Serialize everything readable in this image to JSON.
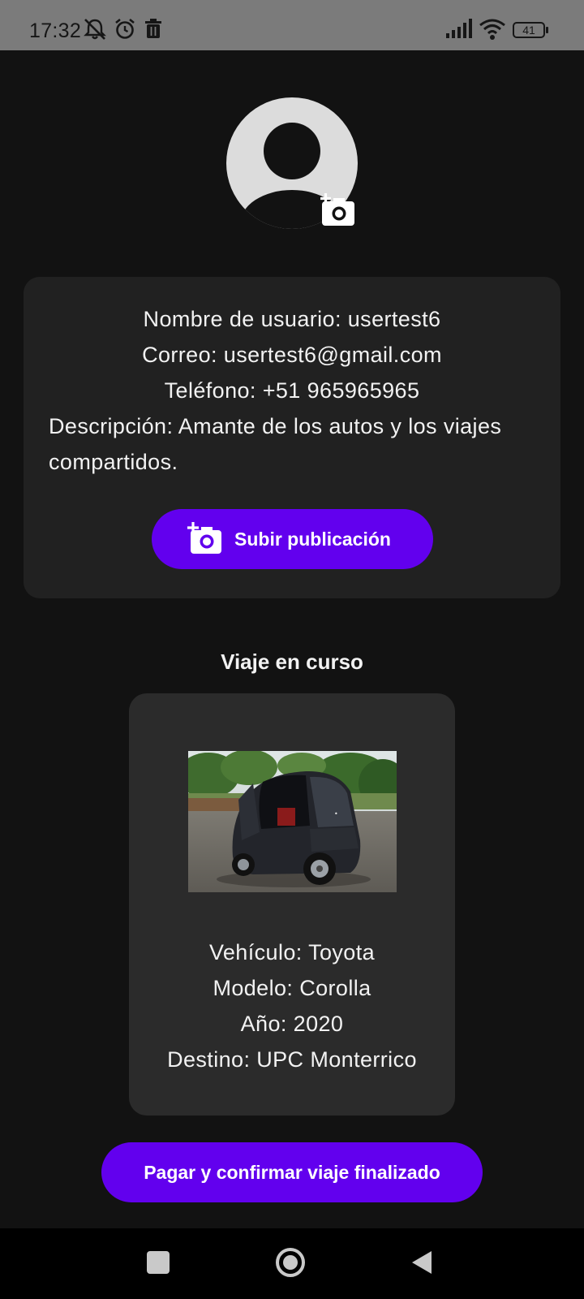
{
  "status_bar": {
    "time": "17:32",
    "battery": "41",
    "icons": [
      "mute-icon",
      "alarm-icon",
      "trash-icon",
      "signal-icon",
      "wifi-icon",
      "battery-icon"
    ]
  },
  "profile": {
    "username_line": "Nombre de usuario: usertest6",
    "email_line": "Correo: usertest6@gmail.com",
    "phone_line": "Teléfono: +51 965965965",
    "description_line": "Descripción: Amante de los autos y los viajes compartidos.",
    "upload_label": "Subir publicación"
  },
  "trip": {
    "heading": "Viaje en curso",
    "vehicle_line": "Vehículo: Toyota",
    "model_line": "Modelo: Corolla",
    "year_line": "Año: 2020",
    "destination_line": "Destino: UPC Monterrico",
    "confirm_label": "Pagar y confirmar viaje finalizado"
  },
  "nav": {
    "buttons": [
      "recents-button",
      "home-button",
      "back-button"
    ]
  },
  "colors": {
    "background": "#121212",
    "card": "#212121",
    "trip_card": "#2b2b2b",
    "accent": "#6200ee",
    "status_bar": "#7b7b7b"
  }
}
